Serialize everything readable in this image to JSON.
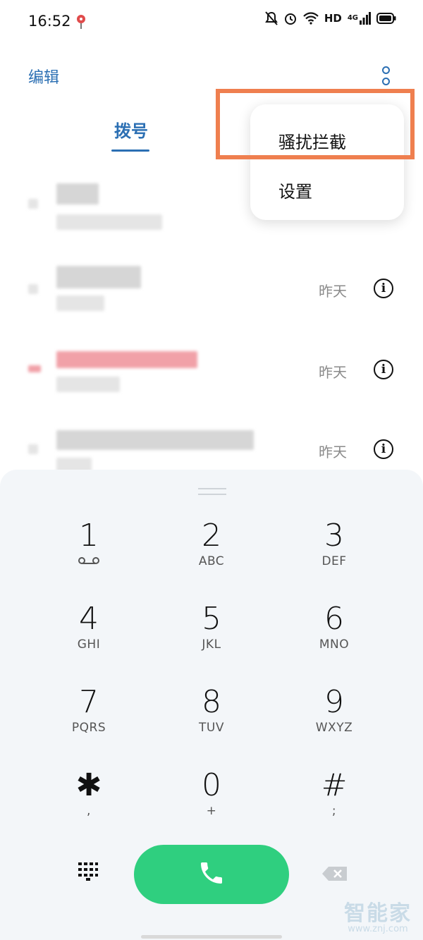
{
  "status_bar": {
    "time": "16:52",
    "hd": "HD",
    "network": "4G"
  },
  "header": {
    "edit_label": "编辑"
  },
  "tabs": [
    {
      "label": "拨号",
      "active": true
    }
  ],
  "menu": {
    "items": [
      "骚扰拦截",
      "设置"
    ],
    "highlighted_item": "骚扰拦截"
  },
  "call_log": [
    {
      "date": "",
      "missed": false,
      "info_button": false
    },
    {
      "date": "昨天",
      "missed": false,
      "info_button": true
    },
    {
      "date": "昨天",
      "missed": true,
      "info_button": true
    },
    {
      "date": "昨天",
      "missed": false,
      "info_button": true
    }
  ],
  "dialpad": {
    "keys": [
      {
        "digit": "1",
        "letters": ""
      },
      {
        "digit": "2",
        "letters": "ABC"
      },
      {
        "digit": "3",
        "letters": "DEF"
      },
      {
        "digit": "4",
        "letters": "GHI"
      },
      {
        "digit": "5",
        "letters": "JKL"
      },
      {
        "digit": "6",
        "letters": "MNO"
      },
      {
        "digit": "7",
        "letters": "PQRS"
      },
      {
        "digit": "8",
        "letters": "TUV"
      },
      {
        "digit": "9",
        "letters": "WXYZ"
      },
      {
        "digit": "✱",
        "letters": ","
      },
      {
        "digit": "0",
        "letters": "+"
      },
      {
        "digit": "#",
        "letters": ";"
      }
    ]
  },
  "colors": {
    "accent": "#2b6fb3",
    "call_green": "#2fcf7f",
    "highlight_orange": "#ef7f4f",
    "missed_red": "#f1a1a8"
  },
  "watermark": {
    "main": "智能家",
    "sub": "www.znj.com"
  }
}
